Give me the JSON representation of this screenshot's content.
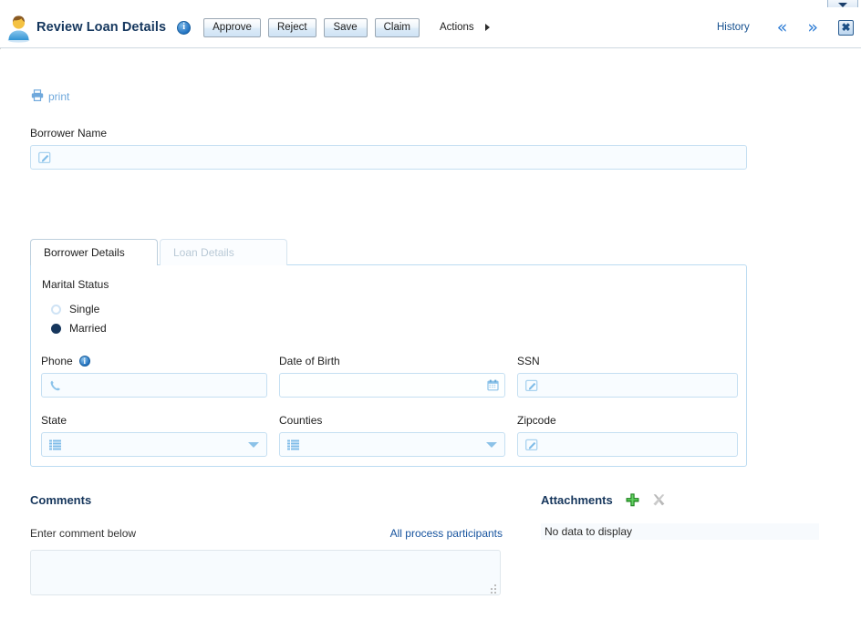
{
  "window": {
    "scroll_up_icon": "triangle-down-icon"
  },
  "header": {
    "avatar_icon": "user-avatar-icon",
    "title": "Review Loan Details",
    "info_icon": "info-icon",
    "info_glyph": "i",
    "buttons": [
      {
        "label": "Approve",
        "name": "approve-button"
      },
      {
        "label": "Reject",
        "name": "reject-button"
      },
      {
        "label": "Save",
        "name": "save-button"
      },
      {
        "label": "Claim",
        "name": "claim-button"
      }
    ],
    "actions": {
      "label": "Actions",
      "caret_icon": "caret-right-icon"
    },
    "history_label": "History",
    "prev_icon": "chevron-double-left-icon",
    "prev_glyph": "«",
    "next_icon": "chevron-double-right-icon",
    "next_glyph": "»",
    "close_icon": "close-window-icon",
    "close_glyph": "✖"
  },
  "toolbar": {
    "print_label": "print",
    "print_icon": "printer-icon"
  },
  "form": {
    "borrower_name": {
      "label": "Borrower Name",
      "value": "",
      "placeholder": "",
      "icon": "edit-pencil-icon"
    },
    "tabs": [
      {
        "label": "Borrower Details",
        "name": "tab-borrower-details",
        "state": "active"
      },
      {
        "label": "Loan Details",
        "name": "tab-loan-details",
        "state": "disabled"
      }
    ],
    "marital_status": {
      "label": "Marital Status",
      "options": [
        {
          "label": "Single",
          "selected": false
        },
        {
          "label": "Married",
          "selected": true
        }
      ]
    },
    "phone": {
      "label": "Phone",
      "value": "",
      "icon": "phone-handset-icon",
      "info_icon": "info-icon",
      "info_glyph": "i"
    },
    "date_of_birth": {
      "label": "Date of Birth",
      "value": "",
      "icon": "calendar-icon"
    },
    "ssn": {
      "label": "SSN",
      "value": "",
      "icon": "edit-pencil-icon"
    },
    "state": {
      "label": "State",
      "value": "",
      "icon": "list-icon",
      "dropdown_icon": "triangle-down-icon"
    },
    "counties": {
      "label": "Counties",
      "value": "",
      "icon": "list-icon",
      "dropdown_icon": "triangle-down-icon"
    },
    "zipcode": {
      "label": "Zipcode",
      "value": "",
      "icon": "edit-pencil-icon"
    }
  },
  "comments": {
    "title": "Comments",
    "hint": "Enter comment below",
    "participants_link": "All process participants",
    "textarea_value": "",
    "resize_icon": "resize-grip-icon"
  },
  "attachments": {
    "title": "Attachments",
    "add_icon": "plus-icon",
    "delete_icon": "delete-x-icon",
    "empty_text": "No data to display"
  },
  "colors": {
    "title_blue": "#14365c",
    "link_blue": "#16539e",
    "field_border": "#c5dff2",
    "accent_green": "#2fae2f"
  }
}
